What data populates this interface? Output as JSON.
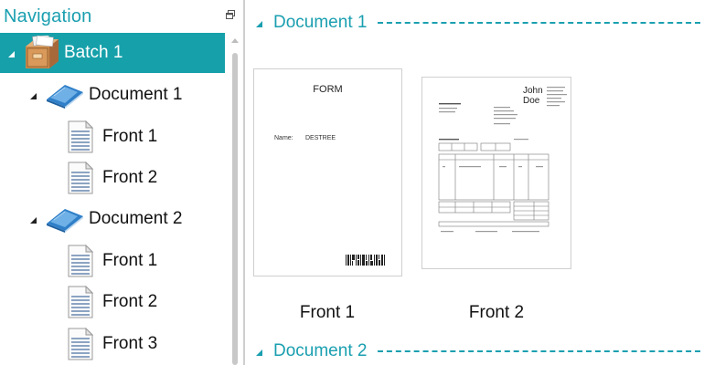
{
  "navigation": {
    "title": "Navigation",
    "tree": {
      "batch": {
        "label": "Batch 1"
      },
      "document1": {
        "label": "Document 1"
      },
      "doc1_pages": [
        "Front 1",
        "Front 2"
      ],
      "document2": {
        "label": "Document 2"
      },
      "doc2_pages": [
        "Front 1",
        "Front 2",
        "Front 3"
      ]
    }
  },
  "content": {
    "group1": {
      "title": "Document 1",
      "pages": [
        {
          "label": "Front 1",
          "preview": {
            "heading": "FORM",
            "field_label": "Name:",
            "field_value": "DESTREE"
          }
        },
        {
          "label": "Front 2",
          "preview": {
            "name_line1": "John",
            "name_line2": "Doe"
          }
        }
      ]
    },
    "group2": {
      "title": "Document 2"
    }
  },
  "colors": {
    "accent": "#16a0aa",
    "text": "#111111"
  }
}
